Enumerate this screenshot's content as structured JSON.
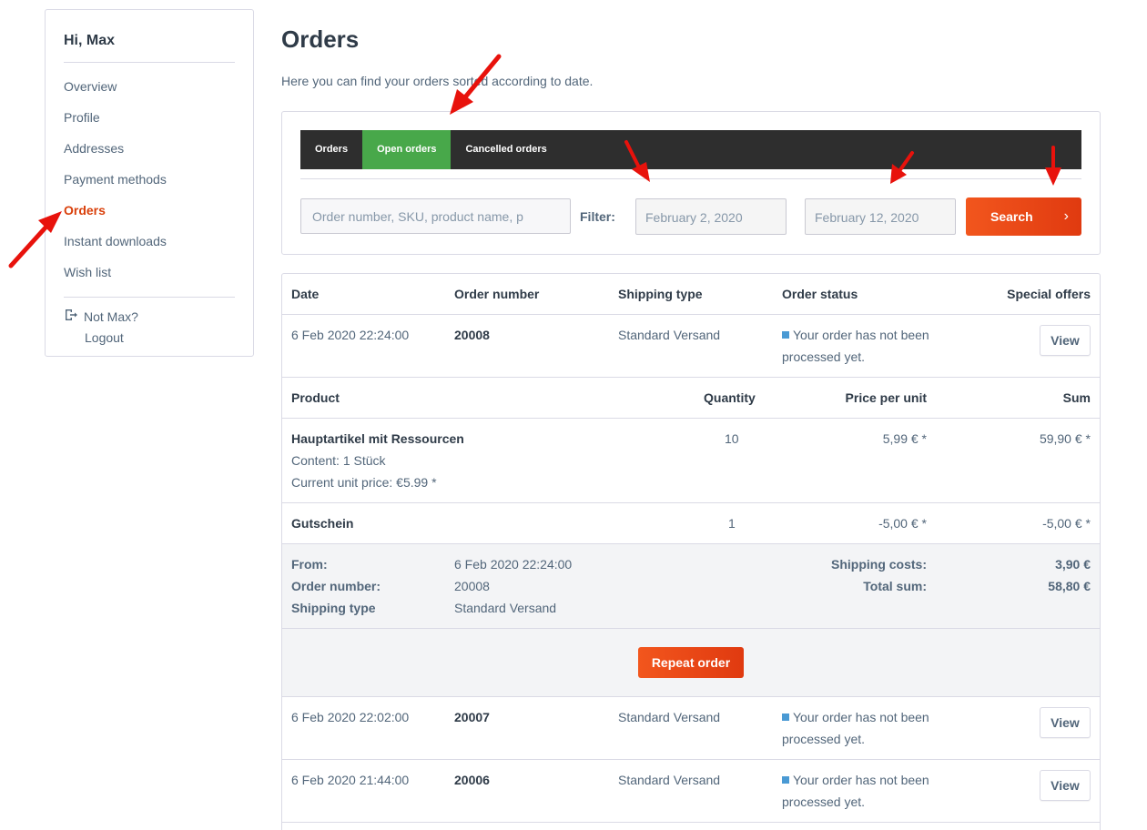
{
  "sidebar": {
    "greeting": "Hi, Max",
    "items": [
      {
        "label": "Overview"
      },
      {
        "label": "Profile"
      },
      {
        "label": "Addresses"
      },
      {
        "label": "Payment methods"
      },
      {
        "label": "Orders"
      },
      {
        "label": "Instant downloads"
      },
      {
        "label": "Wish list"
      }
    ],
    "not_user": "Not Max?",
    "logout": "Logout"
  },
  "main": {
    "title": "Orders",
    "intro": "Here you can find your orders sorted according to date."
  },
  "tabs": [
    {
      "label": "Orders"
    },
    {
      "label": "Open orders"
    },
    {
      "label": "Cancelled orders"
    }
  ],
  "filter": {
    "search_placeholder": "Order number, SKU, product name, p",
    "label": "Filter:",
    "date_from": "February 2, 2020",
    "date_to": "February 12, 2020",
    "search_label": "Search"
  },
  "table": {
    "headers": {
      "date": "Date",
      "order_number": "Order number",
      "shipping_type": "Shipping type",
      "order_status": "Order status",
      "special_offers": "Special offers"
    },
    "view_label": "View",
    "orders": [
      {
        "date": "6 Feb 2020 22:24:00",
        "number": "20008",
        "shipping": "Standard Versand",
        "status_line1": "Your order has not been",
        "status_line2": "processed yet."
      },
      {
        "date": "6 Feb 2020 22:02:00",
        "number": "20007",
        "shipping": "Standard Versand",
        "status_line1": "Your order has not been",
        "status_line2": "processed yet."
      },
      {
        "date": "6 Feb 2020 21:44:00",
        "number": "20006",
        "shipping": "Standard Versand",
        "status_line1": "Your order has not been",
        "status_line2": "processed yet."
      }
    ],
    "detail": {
      "headers": {
        "product": "Product",
        "quantity": "Quantity",
        "price_per_unit": "Price per unit",
        "sum": "Sum"
      },
      "items": [
        {
          "name": "Hauptartikel mit Ressourcen",
          "content": "Content: 1 Stück",
          "current_price": "Current unit price: €5.99 *",
          "quantity": "10",
          "price": "5,99 € *",
          "sum": "59,90 € *"
        },
        {
          "name": "Gutschein",
          "quantity": "1",
          "price": "-5,00 € *",
          "sum": "-5,00 € *"
        }
      ],
      "summary": {
        "from_label": "From:",
        "from_value": "6 Feb 2020 22:24:00",
        "order_number_label": "Order number:",
        "order_number_value": "20008",
        "shipping_type_label": "Shipping type",
        "shipping_type_value": "Standard Versand",
        "shipping_costs_label": "Shipping costs:",
        "shipping_costs_value": "3,90 €",
        "total_label": "Total sum:",
        "total_value": "58,80 €"
      },
      "repeat_label": "Repeat order"
    }
  },
  "colors": {
    "accent": "#d9400b",
    "button": "#e8441a",
    "active_tab": "#48a84a",
    "tabbar": "#2e2e2e",
    "status_dot": "#4a9ad4",
    "annotation": "#e8120c"
  }
}
